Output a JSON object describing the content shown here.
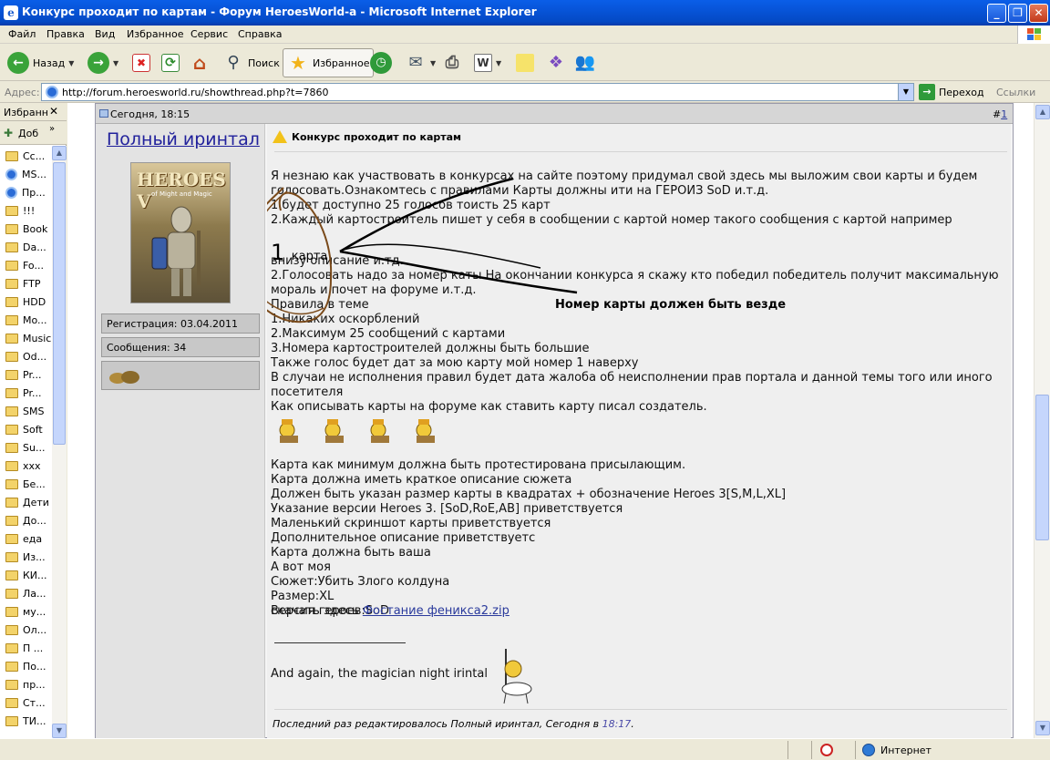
{
  "window": {
    "title": "Конкурс проходит по картам - Форум HeroesWorld-a - Microsoft Internet Explorer"
  },
  "menu": [
    "Файл",
    "Правка",
    "Вид",
    "Избранное",
    "Сервис",
    "Справка"
  ],
  "toolbar": {
    "back": "Назад",
    "search": "Поиск",
    "favorites": "Избранное"
  },
  "address": {
    "label": "Адрес:",
    "url": "http://forum.heroesworld.ru/showthread.php?t=7860",
    "go": "Переход",
    "links": "Ссылки"
  },
  "favorites_pane": {
    "title": "Избранн",
    "add": "Доб",
    "items": [
      {
        "label": "Сс...",
        "type": "folder"
      },
      {
        "label": "MS...",
        "type": "page"
      },
      {
        "label": "Пр...",
        "type": "page"
      },
      {
        "label": "!!!",
        "type": "folder"
      },
      {
        "label": "Book",
        "type": "folder"
      },
      {
        "label": "Da...",
        "type": "folder"
      },
      {
        "label": "Fo...",
        "type": "folder"
      },
      {
        "label": "FTP",
        "type": "folder"
      },
      {
        "label": "HDD",
        "type": "folder"
      },
      {
        "label": "Mo...",
        "type": "folder"
      },
      {
        "label": "Music",
        "type": "folder"
      },
      {
        "label": "Od...",
        "type": "folder"
      },
      {
        "label": "Pr...",
        "type": "folder"
      },
      {
        "label": "Pr...",
        "type": "folder"
      },
      {
        "label": "SMS",
        "type": "folder"
      },
      {
        "label": "Soft",
        "type": "folder"
      },
      {
        "label": "Su...",
        "type": "folder"
      },
      {
        "label": "xxx",
        "type": "folder"
      },
      {
        "label": "Бе...",
        "type": "folder"
      },
      {
        "label": "Дети",
        "type": "folder"
      },
      {
        "label": "До...",
        "type": "folder"
      },
      {
        "label": "еда",
        "type": "folder"
      },
      {
        "label": "Из...",
        "type": "folder"
      },
      {
        "label": "КИ...",
        "type": "folder"
      },
      {
        "label": "Ла...",
        "type": "folder"
      },
      {
        "label": "му...",
        "type": "folder"
      },
      {
        "label": "Ол...",
        "type": "folder"
      },
      {
        "label": "П ...",
        "type": "folder"
      },
      {
        "label": "По...",
        "type": "folder"
      },
      {
        "label": "пр...",
        "type": "folder"
      },
      {
        "label": "Ст...",
        "type": "folder"
      },
      {
        "label": "ТИ...",
        "type": "folder"
      }
    ]
  },
  "post": {
    "date": "Сегодня, 18:15",
    "number_prefix": "#",
    "number": "1",
    "user": {
      "name": "Полный иринтал",
      "avatar_text": "HEROES V",
      "avatar_sub": "of Might and Magic",
      "registration": "Регистрация: 03.04.2011",
      "messages": "Сообщения: 34"
    },
    "title": "Конкурс проходит по картам",
    "annotation": "Номер карты должен быть везде",
    "big_number": "1",
    "big_number_suffix": "карта",
    "lines": [
      "Я незнаю как участвовать в конкурсах на сайте поэтому придумал свой здесь мы выложим свои карты и будем",
      "голосовать.Ознакомтесь с правилами Карты должны ити на ГЕРОИЗ SoD и.т.д.",
      "1.будет доступно 25 голосов тоисть 25 карт",
      "2.Каждый картостроитель пишет у себя в сообщении с картой номер такого сообщения с картой например",
      "внизу описание и.тд.",
      "2.Голосовать надо за номер каты.На окончании конкурса я скажу кто победил победитель получит максимальную",
      "мораль и почет на форуме и.т.д.",
      "Правила в теме",
      "1.Никаких оскорблений",
      "2.Максимум 25 сообщений с картами",
      "3.Номера картостроителей должны быть большие",
      "Также голос будет дат за мою карту мой номер 1 наверху",
      "В случаи не исполнения правил будет дата жалоба об неисполнении прав портала и данной темы того или иного",
      "посетителя",
      "Как описывать карты на форуме как ставить карту писал создатель."
    ],
    "lines2": [
      "Карта как минимум должна быть протестирована присылающим.",
      "Карта должна иметь краткое описание сюжета",
      "Должен быть указан размер карты в квадратах + обозначение Heroes 3[S,M,L,XL]",
      "Указание версии Heroes 3. [SoD,RoE,AB] приветствуется",
      "Маленький скриншот карты приветствуется",
      "Дополнительное описание приветствуетс",
      "Карта должна быть ваша",
      "А вот моя",
      "Сюжет:Убить Злого колдуна",
      "Размер:XL",
      "Версия героев:SoD"
    ],
    "download_prefix": "скачать здесь ",
    "download_link": "Фостание феникса2.zip",
    "signature": "And again, the magician night irintal",
    "edited_prefix": "Последний раз редактировалось Полный иринтал, Сегодня в ",
    "edited_time": "18:17",
    "edited_suffix": "."
  },
  "status": {
    "zone": "Интернет"
  }
}
